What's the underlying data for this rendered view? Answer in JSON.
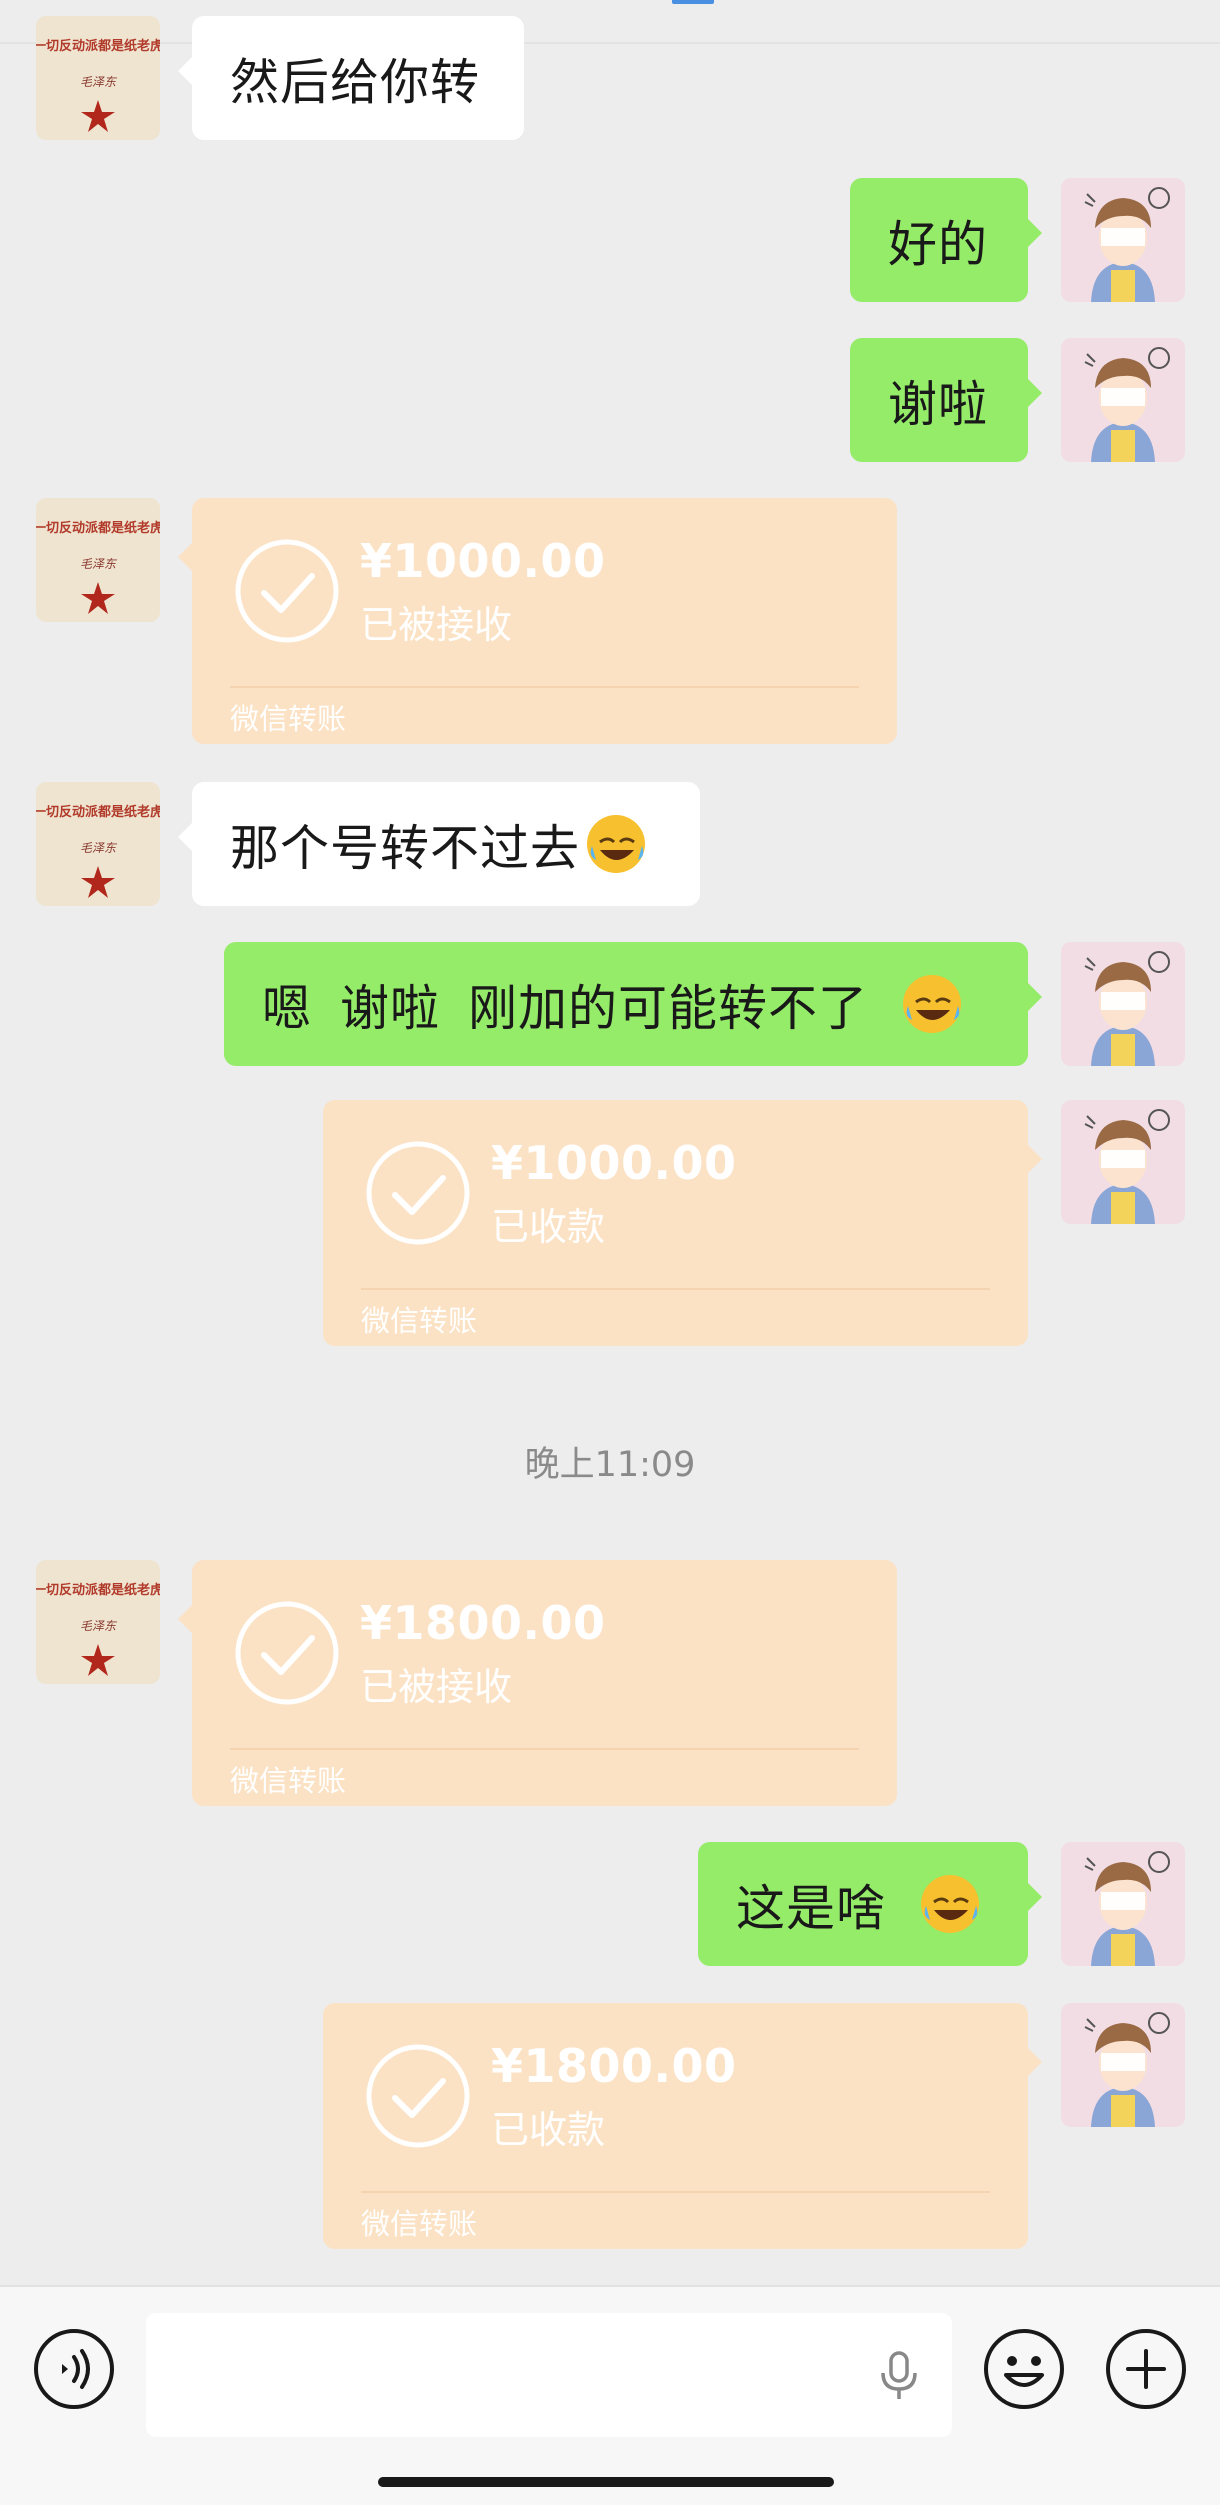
{
  "messages": [
    {
      "id": "m1",
      "side": "left",
      "type": "text",
      "text": "然后给你转"
    },
    {
      "id": "m2",
      "side": "right",
      "type": "text",
      "text": "好的"
    },
    {
      "id": "m3",
      "side": "right",
      "type": "text",
      "text": "谢啦"
    },
    {
      "id": "m4",
      "side": "left",
      "type": "transfer",
      "amount": "¥1000.00",
      "status": "已被接收",
      "footer": "微信转账"
    },
    {
      "id": "m5",
      "side": "left",
      "type": "text",
      "text": "那个号转不过去",
      "emoji": "rolling-laughing-emoji"
    },
    {
      "id": "m6",
      "side": "right",
      "type": "text",
      "parts": [
        "嗯",
        "谢啦",
        "刚加的可能转不了"
      ],
      "emoji": "rolling-laughing-emoji"
    },
    {
      "id": "m7",
      "side": "right",
      "type": "transfer",
      "amount": "¥1000.00",
      "status": "已收款",
      "footer": "微信转账"
    },
    {
      "id": "m8",
      "side": "left",
      "type": "transfer",
      "amount": "¥1800.00",
      "status": "已被接收",
      "footer": "微信转账"
    },
    {
      "id": "m9",
      "side": "right",
      "type": "text",
      "text": "这是啥",
      "emoji": "rolling-laughing-emoji"
    },
    {
      "id": "m10",
      "side": "right",
      "type": "transfer",
      "amount": "¥1800.00",
      "status": "已收款",
      "footer": "微信转账"
    }
  ],
  "timestamp": "晚上11:09",
  "contact_avatar": {
    "line1": "一切反动派都是纸老虎",
    "line2": "毛泽东"
  },
  "input_bar": {
    "icons": [
      "voice-icon",
      "microphone-icon",
      "emoji-icon",
      "plus-icon"
    ]
  },
  "colors": {
    "background": "#ededed",
    "sent_bubble": "#95ec69",
    "received_bubble": "#ffffff",
    "transfer_card": "#fce2c4"
  }
}
